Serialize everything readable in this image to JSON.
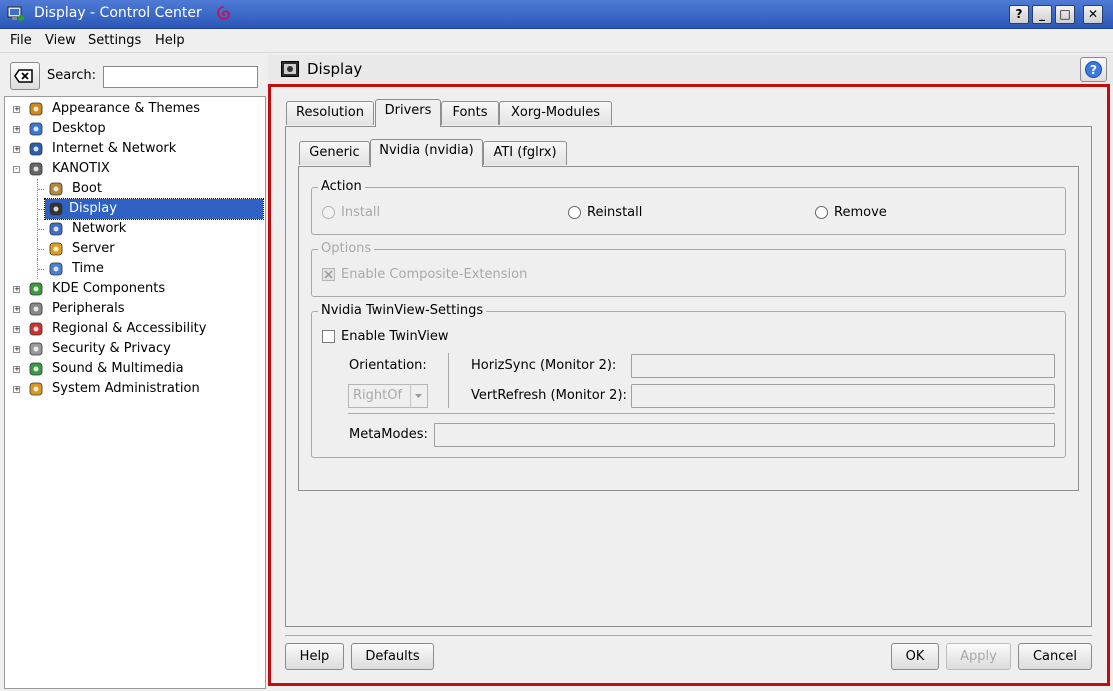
{
  "window": {
    "title": "Display - Control Center",
    "buttons": [
      "?",
      "_",
      "□",
      "✕"
    ]
  },
  "menubar": {
    "items": [
      "File",
      "View",
      "Settings",
      "Help"
    ]
  },
  "search": {
    "label": "Search:",
    "value": ""
  },
  "tree": {
    "items": [
      {
        "label": "Appearance & Themes",
        "icon": "appearance-icon",
        "expander": "+"
      },
      {
        "label": "Desktop",
        "icon": "desktop-icon",
        "expander": "+"
      },
      {
        "label": "Internet & Network",
        "icon": "internet-icon",
        "expander": "+"
      },
      {
        "label": "KANOTIX",
        "icon": "kanotix-icon",
        "expander": "-"
      },
      {
        "label": "Boot",
        "icon": "boot-icon",
        "child": true
      },
      {
        "label": "Display",
        "icon": "display-icon",
        "child": true,
        "selected": true
      },
      {
        "label": "Network",
        "icon": "network-icon",
        "child": true
      },
      {
        "label": "Server",
        "icon": "server-icon",
        "child": true
      },
      {
        "label": "Time",
        "icon": "clock-icon",
        "child": true
      },
      {
        "label": "KDE Components",
        "icon": "kde-components-icon",
        "expander": "+"
      },
      {
        "label": "Peripherals",
        "icon": "peripherals-icon",
        "expander": "+"
      },
      {
        "label": "Regional & Accessibility",
        "icon": "regional-icon",
        "expander": "+"
      },
      {
        "label": "Security & Privacy",
        "icon": "security-icon",
        "expander": "+"
      },
      {
        "label": "Sound & Multimedia",
        "icon": "sound-icon",
        "expander": "+"
      },
      {
        "label": "System Administration",
        "icon": "sysadmin-icon",
        "expander": "+"
      }
    ]
  },
  "header": {
    "title": "Display"
  },
  "tabs": [
    "Resolution",
    "Drivers",
    "Fonts",
    "Xorg-Modules"
  ],
  "subtabs": [
    "Generic",
    "Nvidia (nvidia)",
    "ATI (fglrx)"
  ],
  "action": {
    "legend": "Action",
    "install": "Install",
    "reinstall": "Reinstall",
    "remove": "Remove"
  },
  "options": {
    "legend": "Options",
    "composite": "Enable Composite-Extension"
  },
  "twinview": {
    "legend": "Nvidia TwinView-Settings",
    "enable": "Enable TwinView",
    "orientation_label": "Orientation:",
    "orientation_value": "RightOf",
    "hsync_label": "HorizSync (Monitor 2):",
    "vrefresh_label": "VertRefresh (Monitor 2):",
    "metamodes_label": "MetaModes:"
  },
  "buttons": {
    "help": "Help",
    "defaults": "Defaults",
    "ok": "OK",
    "apply": "Apply",
    "cancel": "Cancel"
  },
  "colors": {
    "selection": "#3062c5",
    "titlebar": "#2b57b8",
    "frame": "#c10d0d"
  }
}
